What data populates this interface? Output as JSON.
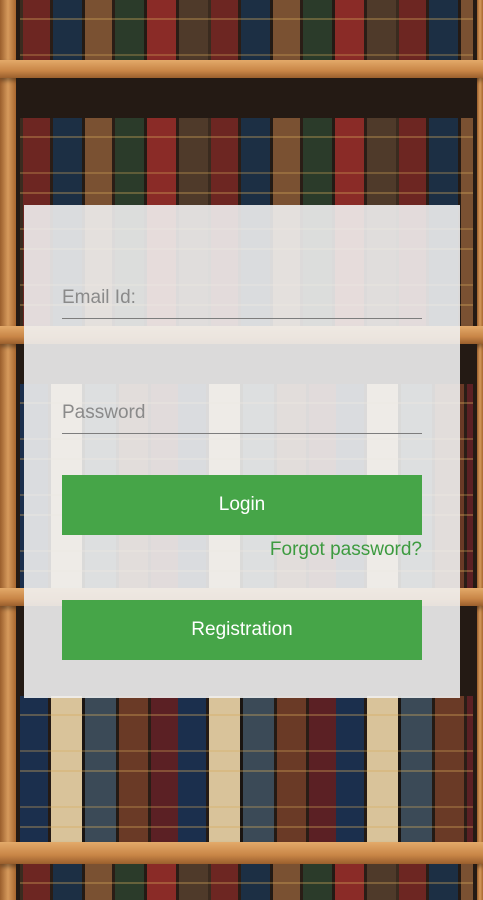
{
  "login_form": {
    "email_placeholder": "Email Id:",
    "email_value": "",
    "password_placeholder": "Password",
    "password_value": "",
    "login_label": "Login",
    "forgot_label": "Forgot password?",
    "register_label": "Registration"
  },
  "colors": {
    "primary_button": "#46a548",
    "link": "#3d9b40",
    "card_background": "#f0f0f0"
  }
}
